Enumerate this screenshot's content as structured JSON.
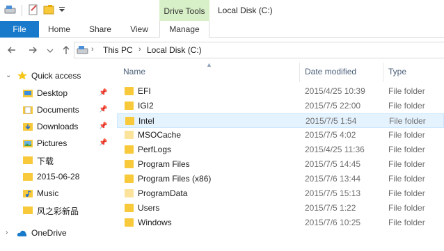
{
  "title_bar": {
    "context_tab_group": "Drive Tools",
    "window_title": "Local Disk (C:)"
  },
  "ribbon": {
    "file_tab": "File",
    "tabs": [
      "Home",
      "Share",
      "View",
      "Manage"
    ]
  },
  "address_bar": {
    "back_icon": "arrow-left-icon",
    "forward_icon": "arrow-right-icon",
    "history_icon": "chevron-down-icon",
    "up_icon": "arrow-up-icon",
    "crumbs": [
      "This PC",
      "Local Disk (C:)"
    ]
  },
  "nav_pane": {
    "quick_access": "Quick access",
    "items": [
      {
        "label": "Desktop",
        "icon": "desktop-folder-icon",
        "pinned": true
      },
      {
        "label": "Documents",
        "icon": "documents-folder-icon",
        "pinned": true
      },
      {
        "label": "Downloads",
        "icon": "downloads-folder-icon",
        "pinned": true
      },
      {
        "label": "Pictures",
        "icon": "pictures-folder-icon",
        "pinned": true
      },
      {
        "label": "下载",
        "icon": "folder-icon",
        "pinned": false
      },
      {
        "label": "2015-06-28",
        "icon": "folder-icon",
        "pinned": false
      },
      {
        "label": "Music",
        "icon": "music-folder-icon",
        "pinned": false
      },
      {
        "label": "风之彩新品",
        "icon": "folder-icon",
        "pinned": false
      }
    ],
    "onedrive": "OneDrive"
  },
  "file_list": {
    "columns": {
      "name": "Name",
      "date": "Date modified",
      "type": "Type"
    },
    "rows": [
      {
        "name": "EFI",
        "date": "2015/4/25 10:39",
        "type": "File folder",
        "selected": false,
        "hidden": false
      },
      {
        "name": "IGI2",
        "date": "2015/7/5 22:00",
        "type": "File folder",
        "selected": false,
        "hidden": false
      },
      {
        "name": "Intel",
        "date": "2015/7/5 1:54",
        "type": "File folder",
        "selected": true,
        "hidden": false
      },
      {
        "name": "MSOCache",
        "date": "2015/7/5 4:02",
        "type": "File folder",
        "selected": false,
        "hidden": true
      },
      {
        "name": "PerfLogs",
        "date": "2015/4/25 11:36",
        "type": "File folder",
        "selected": false,
        "hidden": false
      },
      {
        "name": "Program Files",
        "date": "2015/7/5 14:45",
        "type": "File folder",
        "selected": false,
        "hidden": false
      },
      {
        "name": "Program Files (x86)",
        "date": "2015/7/6 13:44",
        "type": "File folder",
        "selected": false,
        "hidden": false
      },
      {
        "name": "ProgramData",
        "date": "2015/7/5 15:13",
        "type": "File folder",
        "selected": false,
        "hidden": true
      },
      {
        "name": "Users",
        "date": "2015/7/5 1:22",
        "type": "File folder",
        "selected": false,
        "hidden": false
      },
      {
        "name": "Windows",
        "date": "2015/7/6 10:25",
        "type": "File folder",
        "selected": false,
        "hidden": false
      }
    ]
  },
  "colors": {
    "file_tab": "#1979ca",
    "context_tab": "#d8f0c8",
    "selection": "#e5f3ff",
    "folder": "#f8c93a",
    "folder_hidden": "#fbe39c"
  }
}
